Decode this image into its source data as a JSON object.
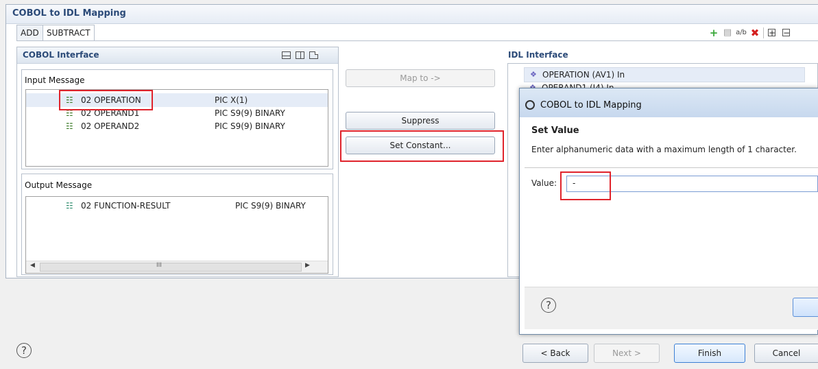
{
  "window": {
    "title": "COBOL to IDL Mapping"
  },
  "tabs": [
    {
      "label": "ADD"
    },
    {
      "label": "SUBTRACT"
    }
  ],
  "toolbar": {
    "icons": [
      "add-icon",
      "copy-icon",
      "rename-icon",
      "delete-icon",
      "expand-all-icon",
      "collapse-all-icon"
    ]
  },
  "cobol_interface": {
    "title": "COBOL Interface",
    "input_message": {
      "label": "Input Message",
      "rows": [
        {
          "name": "02 OPERATION",
          "pic": "PIC X(1)"
        },
        {
          "name": "02 OPERAND1",
          "pic": "PIC S9(9) BINARY"
        },
        {
          "name": "02 OPERAND2",
          "pic": "PIC S9(9) BINARY"
        }
      ]
    },
    "output_message": {
      "label": "Output Message",
      "rows": [
        {
          "name": "02 FUNCTION-RESULT",
          "pic": "PIC S9(9) BINARY"
        }
      ],
      "scroll_glyph": "III"
    }
  },
  "actions": {
    "map_to": "Map to ->",
    "suppress": "Suppress",
    "set_constant": "Set Constant..."
  },
  "idl_interface": {
    "title": "IDL Interface",
    "rows": [
      {
        "text": "OPERATION  (AV1) In"
      },
      {
        "text": "OPERAND1  (I4) In"
      }
    ]
  },
  "dialog": {
    "title": "COBOL to IDL Mapping",
    "heading": "Set Value",
    "description": "Enter alphanumeric data with a maximum length of 1 character.",
    "value_label": "Value:",
    "value": "-"
  },
  "footer": {
    "back": "< Back",
    "next": "Next >",
    "finish": "Finish",
    "cancel": "Cancel"
  },
  "colors": {
    "highlight": "#e0232b",
    "title_blue": "#2b4a78",
    "selection": "#e5ecf7"
  }
}
